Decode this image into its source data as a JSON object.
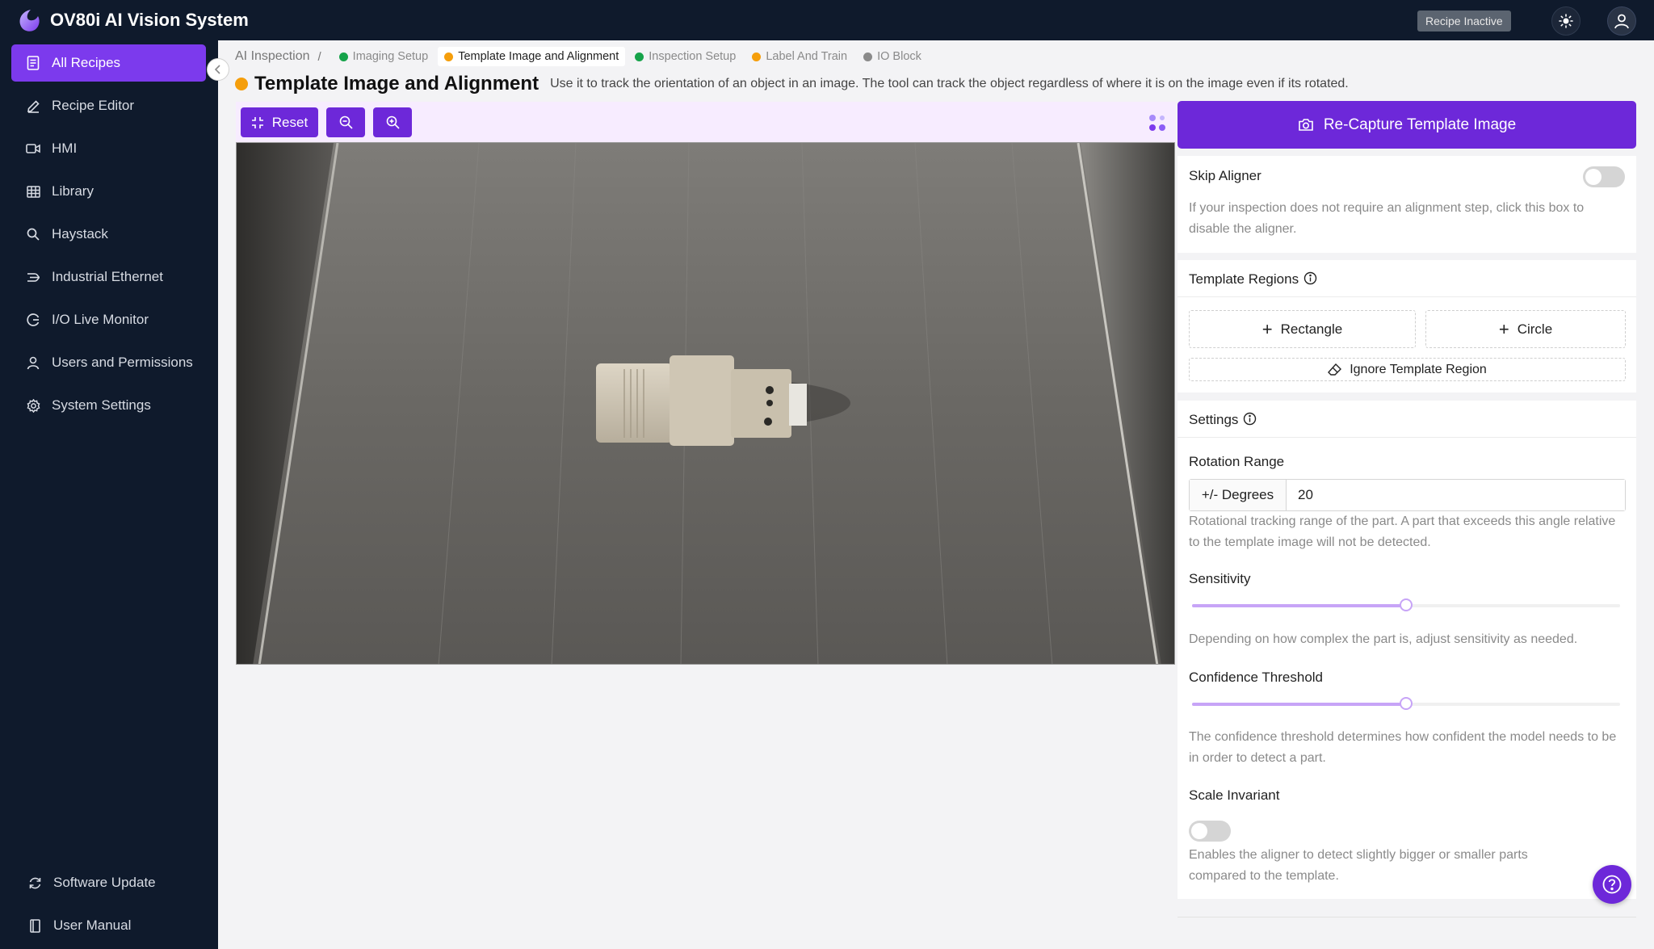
{
  "app": {
    "title": "OV80i AI Vision System",
    "status": "Recipe Inactive"
  },
  "sidebar": {
    "items": [
      {
        "label": "All Recipes",
        "icon": "document-icon"
      },
      {
        "label": "Recipe Editor",
        "icon": "pencil-icon"
      },
      {
        "label": "HMI",
        "icon": "video-icon"
      },
      {
        "label": "Library",
        "icon": "grid-icon"
      },
      {
        "label": "Haystack",
        "icon": "search-icon"
      },
      {
        "label": "Industrial Ethernet",
        "icon": "network-icon"
      },
      {
        "label": "I/O Live Monitor",
        "icon": "monitor-icon"
      },
      {
        "label": "Users and Permissions",
        "icon": "user-icon"
      },
      {
        "label": "System Settings",
        "icon": "gear-icon"
      }
    ],
    "bottom": [
      {
        "label": "Software Update",
        "icon": "refresh-icon"
      },
      {
        "label": "User Manual",
        "icon": "book-icon"
      }
    ]
  },
  "breadcrumb": {
    "root": "AI Inspection",
    "separator": "/",
    "steps": [
      {
        "label": "Imaging Setup",
        "color": "#16a34a"
      },
      {
        "label": "Template Image and Alignment",
        "color": "#f59e0b"
      },
      {
        "label": "Inspection Setup",
        "color": "#16a34a"
      },
      {
        "label": "Label And Train",
        "color": "#f59e0b"
      },
      {
        "label": "IO Block",
        "color": "#8a8a8a"
      }
    ]
  },
  "page": {
    "title": "Template Image and Alignment",
    "description": "Use it to track the orientation of an object in an image. The tool can track the object regardless of where it is on the image even if its rotated.",
    "status_color": "#f59e0b"
  },
  "toolbar": {
    "reset_label": "Reset"
  },
  "panel": {
    "recapture_label": "Re-Capture Template Image",
    "skip_aligner": {
      "label": "Skip Aligner",
      "help": "If your inspection does not require an alignment step, click this box to disable the aligner.",
      "enabled": false
    },
    "template_regions": {
      "title": "Template Regions",
      "rectangle_label": "Rectangle",
      "circle_label": "Circle",
      "ignore_label": "Ignore Template Region"
    },
    "settings": {
      "title": "Settings",
      "rotation_range": {
        "label": "Rotation Range",
        "addon": "+/- Degrees",
        "value": "20",
        "help": "Rotational tracking range of the part. A part that exceeds this angle relative to the template image will not be detected."
      },
      "sensitivity": {
        "label": "Sensitivity",
        "value": 0.5,
        "help": "Depending on how complex the part is, adjust sensitivity as needed."
      },
      "confidence_threshold": {
        "label": "Confidence Threshold",
        "value": 0.5,
        "help": "The confidence threshold determines how confident the model needs to be in order to detect a part."
      },
      "scale_invariant": {
        "label": "Scale Invariant",
        "help": "Enables the aligner to detect slightly bigger or smaller parts compared to the template.",
        "enabled": false
      }
    }
  },
  "colors": {
    "accent": "#6d28d9",
    "sidebar_bg": "#0f1a2c",
    "active_nav": "#7c3aed"
  }
}
